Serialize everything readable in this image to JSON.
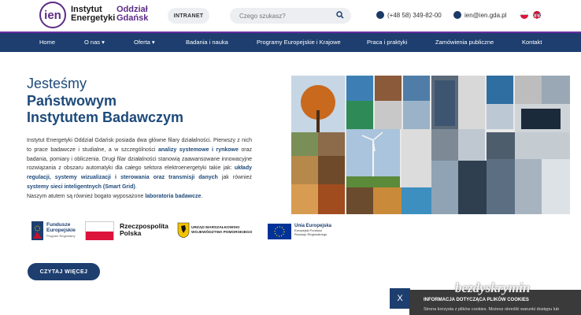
{
  "header": {
    "logo_mark": "ien",
    "logo_name_1": "Instytut",
    "logo_name_2": "Energetyki",
    "logo_branch_1": "Oddział",
    "logo_branch_2": "Gdańsk",
    "intranet_label": "INTRANET",
    "search_placeholder": "Czego szukasz?",
    "phone": "(+48 58) 349-82-00",
    "email": "ien@ien.gda.pl",
    "languages": [
      "polish-flag-icon",
      "english-flag-icon"
    ]
  },
  "nav": {
    "items": [
      {
        "label": "Home"
      },
      {
        "label": "O nas ▾"
      },
      {
        "label": "Oferta ▾"
      },
      {
        "label": "Badania i nauka"
      },
      {
        "label": "Programy Europejskie i Krajowe"
      },
      {
        "label": "Praca i praktyki"
      },
      {
        "label": "Zamówienia publiczne"
      },
      {
        "label": "Kontakt"
      }
    ]
  },
  "hero": {
    "heading_light": "Jesteśmy",
    "heading_bold_1": "Państwowym",
    "heading_bold_2": "Instytutem Badawczym",
    "para_1": "Instytut Energetyki Oddział Gdańsk posiada dwa główne filary działalności. Pierwszy z nich to prace badawcze i studialne, a w szczególności ",
    "para_1_bold": "analizy systemowe i rynkowe",
    "para_2": " oraz badania, pomiary i obliczenia. Drugi filar działalności stanowią zaawansowane innowacyjne rozwiązania z obszaru automatyki dla całego sektora elektroenergetyki takie jak: ",
    "para_2_bold": "układy regulacji, systemy wizualizacji i sterowania oraz transmisji danych",
    "para_3": " jak również ",
    "para_3_bold": "systemy sieci inteligentnych (Smart Grid)",
    "para_4": ".",
    "para_5": "Naszym atutem są również bogato wyposażone ",
    "para_5_bold": "laboratoria badawcze",
    "para_6": ".",
    "button_label": "CZYTAJ WIĘCEJ"
  },
  "funding_logos": {
    "fe_1": "Fundusze",
    "fe_2": "Europejskie",
    "fe_3": "Program Regionalny",
    "rp_1": "Rzeczpospolita",
    "rp_2": "Polska",
    "um_1": "URZĄD MARSZAŁKOWSKI",
    "um_2": "WOJEWÓDZTWA POMORSKIEGO",
    "ue_1": "Unia Europejska",
    "ue_2": "Europejski Fundusz",
    "ue_3": "Rozwoju Regionalnego"
  },
  "cookie": {
    "close_label": "X",
    "title": "INFORMACJA DOTYCZĄCA PLIKÓW COOKIES",
    "text": "Strona korzysta z plików cookies. Możesz określić warunki dostępu lub"
  },
  "watermark": "bezdyskrymin",
  "colors": {
    "navy": "#1d3e6f",
    "purple": "#6a2ea0",
    "heading": "#1d4a7a"
  }
}
